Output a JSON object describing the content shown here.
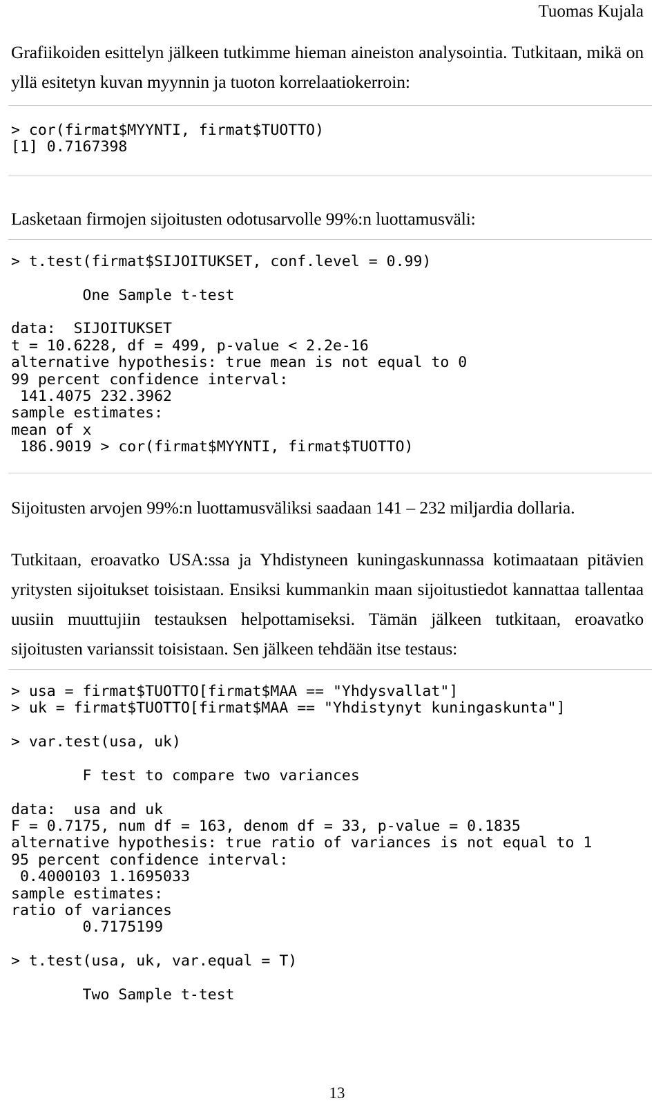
{
  "document": {
    "header_author": "Tuomas Kujala",
    "page_number": "13",
    "rule_color": "#c9c9c9",
    "text_color": "#000000",
    "background_color": "#ffffff"
  },
  "blocks": {
    "intro_paragraph": "Grafiikoiden esittelyn jälkeen tutkimme hieman aineiston analysointia. Tutkitaan, mikä on yllä esitetyn kuvan myynnin ja tuoton korrelaatiokerroin:",
    "code_cor": "> cor(firmat$MYYNTI, firmat$TUOTTO)\n[1] 0.7167398",
    "paragraph_luottamusvali": "Lasketaan firmojen sijoitusten odotusarvolle 99%:n luottamusväli:",
    "code_ttest_one_sample": "> t.test(firmat$SIJOITUKSET, conf.level = 0.99)\n\n        One Sample t-test\n\ndata:  SIJOITUKSET\nt = 10.6228, df = 499, p-value < 2.2e-16\nalternative hypothesis: true mean is not equal to 0\n99 percent confidence interval:\n 141.4075 232.3962\nsample estimates:\nmean of x\n 186.9019 > cor(firmat$MYYNTI, firmat$TUOTTO)",
    "paragraph_tulos": "Sijoitusten arvojen 99%:n luottamusväliksi saadaan 141 – 232 miljardia dollaria.",
    "paragraph_eroavatko": "Tutkitaan, eroavatko USA:ssa ja Yhdistyneen kuningaskunnassa kotimaataan pitävien yritysten sijoitukset toisistaan. Ensiksi kummankin maan sijoitustiedot kannattaa tallentaa uusiin muuttujiin testauksen helpottamiseksi. Tämän jälkeen tutkitaan, eroavatko sijoitusten varianssit toisistaan. Sen jälkeen tehdään itse testaus:",
    "code_vartest": "> usa = firmat$TUOTTO[firmat$MAA == \"Yhdysvallat\"]\n> uk = firmat$TUOTTO[firmat$MAA == \"Yhdistynyt kuningaskunta\"]\n\n> var.test(usa, uk)\n\n        F test to compare two variances\n\ndata:  usa and uk\nF = 0.7175, num df = 163, denom df = 33, p-value = 0.1835\nalternative hypothesis: true ratio of variances is not equal to 1\n95 percent confidence interval:\n 0.4000103 1.1695033\nsample estimates:\nratio of variances\n        0.7175199\n\n> t.test(usa, uk, var.equal = T)\n\n        Two Sample t-test"
  },
  "statistics": {
    "correlation_myynti_tuotto": 0.7167398,
    "one_sample_t_test": {
      "data": "SIJOITUKSET",
      "t": 10.6228,
      "df": 499,
      "p_value": "< 2.2e-16",
      "alternative": "true mean is not equal to 0",
      "conf_level_percent": 99,
      "conf_int": [
        141.4075,
        232.3962
      ],
      "mean_of_x": 186.9019
    },
    "f_test": {
      "data": "usa and uk",
      "F": 0.7175,
      "num_df": 163,
      "denom_df": 33,
      "p_value": 0.1835,
      "alternative": "true ratio of variances is not equal to 1",
      "conf_level_percent": 95,
      "conf_int": [
        0.4000103,
        1.1695033
      ],
      "ratio_of_variances": 0.7175199
    }
  }
}
